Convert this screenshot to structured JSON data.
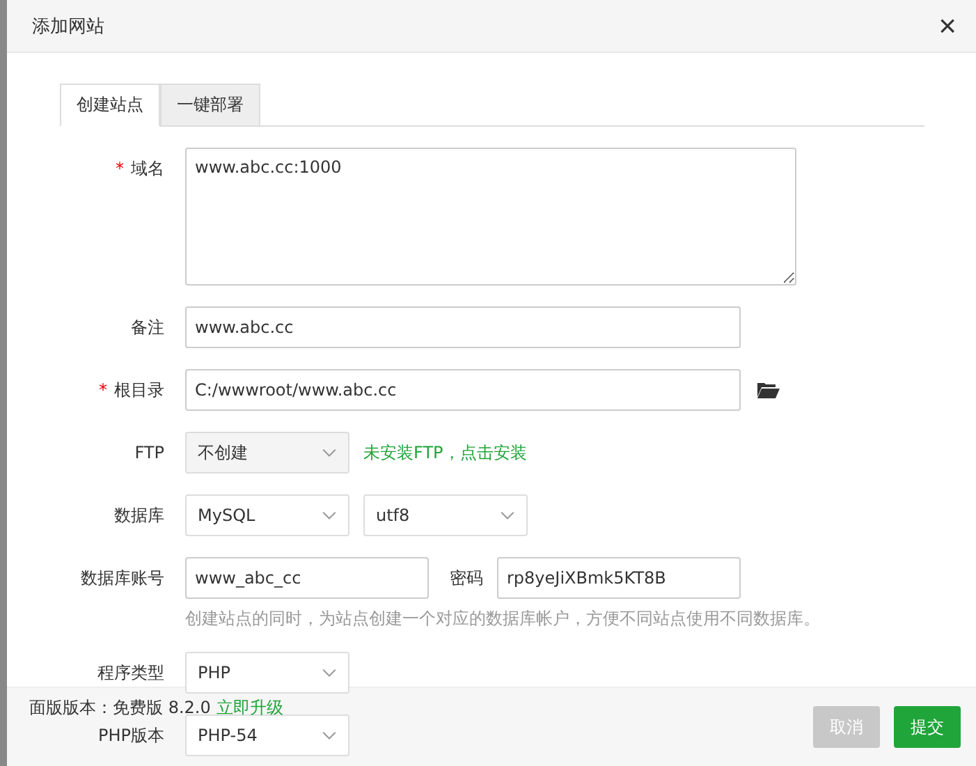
{
  "window": {
    "title": "添加网站",
    "close": "×"
  },
  "tabs": [
    {
      "label": "创建站点",
      "selected": true
    },
    {
      "label": "一键部署",
      "selected": false
    }
  ],
  "rows": [
    {
      "label": "域名",
      "mark": "*",
      "fields": [
        {
          "kind": "textarea",
          "value": "www.abc.cc:1000"
        }
      ]
    },
    {
      "label": "备注",
      "fields": [
        {
          "kind": "input",
          "value": "www.abc.cc"
        }
      ]
    },
    {
      "label": "根目录",
      "mark": "*",
      "fields": [
        {
          "kind": "input",
          "value": "C:/wwwroot/www.abc.cc"
        },
        {
          "kind": "folder"
        }
      ]
    },
    {
      "label": "FTP",
      "fields": [
        {
          "kind": "select",
          "value": "不创建"
        },
        {
          "kind": "link",
          "value": "未安装FTP，点击安装"
        }
      ]
    },
    {
      "label": "数据库",
      "fields": [
        {
          "kind": "select",
          "value": "MySQL"
        },
        {
          "kind": "select",
          "value": "utf8"
        }
      ]
    },
    {
      "label": "数据库账号",
      "fields": [
        {
          "kind": "short",
          "value": "www_abc_cc"
        },
        {
          "kind": "label",
          "value": "密码"
        },
        {
          "kind": "short",
          "value": "rp8yeJiXBmk5KT8B"
        }
      ],
      "hint": "创建站点的同时，为站点创建一个对应的数据库帐户，方便不同站点使用不同数据库。"
    },
    {
      "label": "程序类型",
      "fields": [
        {
          "kind": "select",
          "value": "PHP"
        }
      ]
    },
    {
      "label": "PHP版本",
      "fields": [
        {
          "kind": "select",
          "value": "PHP-54"
        }
      ]
    }
  ],
  "footer": {
    "version": "面版版本：免费版 8.2.0",
    "upgrade": "立即升级",
    "buttons": [
      {
        "label": "取消",
        "kind": "cancel",
        "disabled": true
      },
      {
        "label": "提交",
        "kind": "submit",
        "disabled": false
      }
    ]
  }
}
